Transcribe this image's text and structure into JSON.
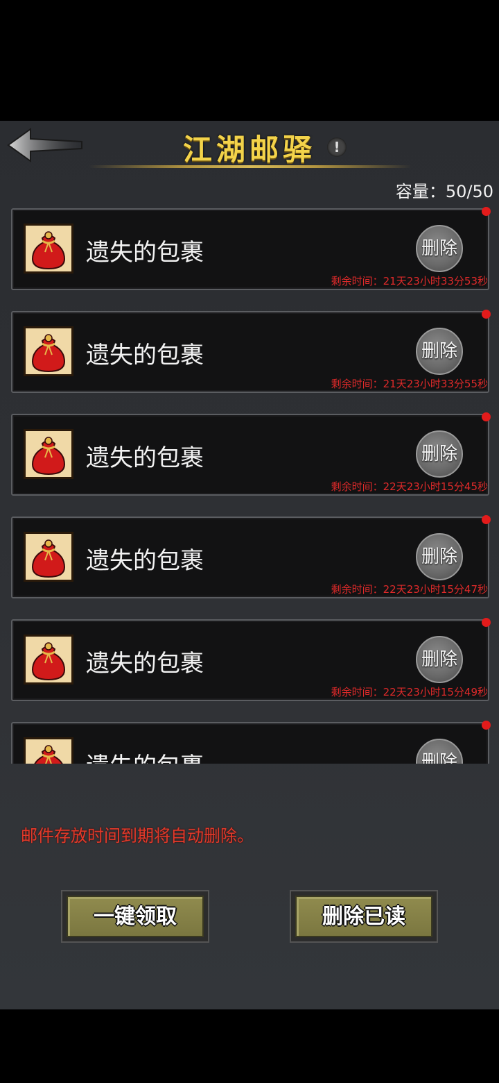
{
  "header": {
    "title": "江湖邮驿",
    "info_glyph": "!",
    "capacity": "容量：50/50"
  },
  "mails": [
    {
      "name": "遗失的包裹",
      "delete_label": "删除",
      "remaining": "剩余时间：21天23小时33分53秒",
      "unread": true
    },
    {
      "name": "遗失的包裹",
      "delete_label": "删除",
      "remaining": "剩余时间：21天23小时33分55秒",
      "unread": true
    },
    {
      "name": "遗失的包裹",
      "delete_label": "删除",
      "remaining": "剩余时间：22天23小时15分45秒",
      "unread": true
    },
    {
      "name": "遗失的包裹",
      "delete_label": "删除",
      "remaining": "剩余时间：22天23小时15分47秒",
      "unread": true
    },
    {
      "name": "遗失的包裹",
      "delete_label": "删除",
      "remaining": "剩余时间：22天23小时15分49秒",
      "unread": true
    },
    {
      "name": "遗失的包裹",
      "delete_label": "删除",
      "remaining": "",
      "unread": true
    }
  ],
  "footer": {
    "notice": "邮件存放时间到期将自动删除。",
    "claim_all_label": "一键领取",
    "delete_read_label": "删除已读"
  },
  "colors": {
    "title": "#f3d34a",
    "alert_red": "#e02a2a",
    "button_olive": "#868246"
  },
  "icons": {
    "back": "back-arrow-icon",
    "info": "info-icon",
    "item": "red-pouch-icon"
  }
}
